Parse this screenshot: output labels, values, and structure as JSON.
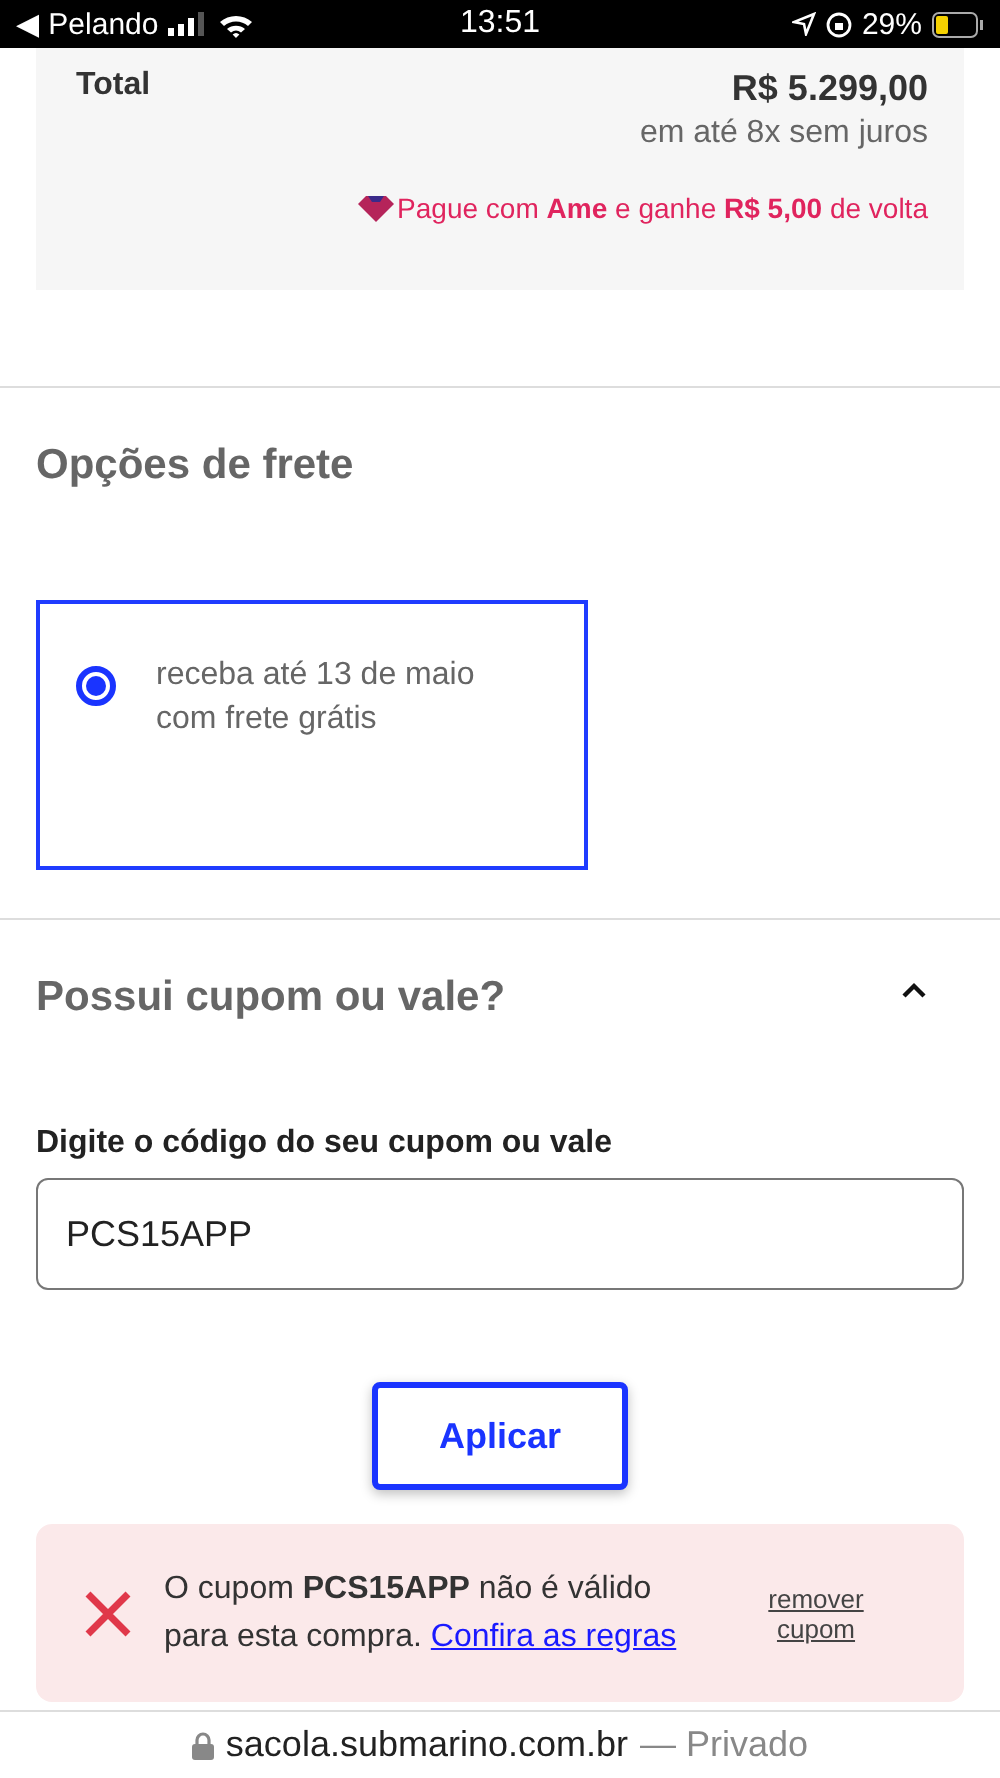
{
  "status_bar": {
    "carrier": "◀ Pelando",
    "time": "13:51",
    "battery": "29%"
  },
  "summary": {
    "label": "Total",
    "price": "R$ 5.299,00",
    "installments": "em até 8x sem juros",
    "promo": "Pague com **Ame** e ganhe **R$ 5,00** de volta"
  },
  "shipping": {
    "title": "Opções de frete",
    "options": [
      {
        "lines": [
          "receba até 13 de maio",
          "com frete grátis"
        ],
        "selected": true
      }
    ]
  },
  "coupon": {
    "title": "Possui cupom ou vale?",
    "expanded": true,
    "field_label": "Digite o código do seu cupom ou vale",
    "value": "PCS15APP",
    "button": "Aplicar",
    "error": {
      "message": "O cupom **PCS15APP** não é válido para esta compra.",
      "link": "Confira as regras",
      "remove": "remover cupom"
    }
  },
  "url_bar": {
    "domain": "sacola.submarino.com.br",
    "suffix": "— Privado"
  }
}
